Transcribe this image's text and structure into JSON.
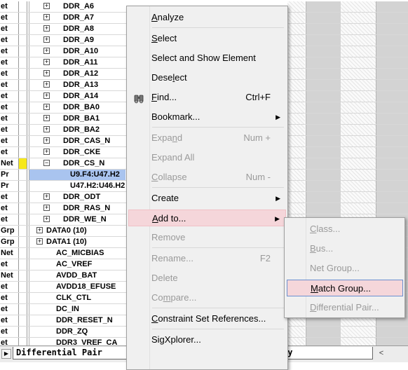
{
  "rows": [
    {
      "type": "et",
      "mark": false,
      "toggle": "+",
      "indent": 1,
      "name": "DDR_A6",
      "highlight": false
    },
    {
      "type": "et",
      "mark": false,
      "toggle": "+",
      "indent": 1,
      "name": "DDR_A7",
      "highlight": false
    },
    {
      "type": "et",
      "mark": false,
      "toggle": "+",
      "indent": 1,
      "name": "DDR_A8",
      "highlight": false
    },
    {
      "type": "et",
      "mark": false,
      "toggle": "+",
      "indent": 1,
      "name": "DDR_A9",
      "highlight": false
    },
    {
      "type": "et",
      "mark": false,
      "toggle": "+",
      "indent": 1,
      "name": "DDR_A10",
      "highlight": false
    },
    {
      "type": "et",
      "mark": false,
      "toggle": "+",
      "indent": 1,
      "name": "DDR_A11",
      "highlight": false
    },
    {
      "type": "et",
      "mark": false,
      "toggle": "+",
      "indent": 1,
      "name": "DDR_A12",
      "highlight": false
    },
    {
      "type": "et",
      "mark": false,
      "toggle": "+",
      "indent": 1,
      "name": "DDR_A13",
      "highlight": false
    },
    {
      "type": "et",
      "mark": false,
      "toggle": "+",
      "indent": 1,
      "name": "DDR_A14",
      "highlight": false
    },
    {
      "type": "et",
      "mark": false,
      "toggle": "+",
      "indent": 1,
      "name": "DDR_BA0",
      "highlight": false
    },
    {
      "type": "et",
      "mark": false,
      "toggle": "+",
      "indent": 1,
      "name": "DDR_BA1",
      "highlight": false
    },
    {
      "type": "et",
      "mark": false,
      "toggle": "+",
      "indent": 1,
      "name": "DDR_BA2",
      "highlight": false
    },
    {
      "type": "et",
      "mark": false,
      "toggle": "+",
      "indent": 1,
      "name": "DDR_CAS_N",
      "highlight": false
    },
    {
      "type": "et",
      "mark": false,
      "toggle": "+",
      "indent": 1,
      "name": "DDR_CKE",
      "highlight": false
    },
    {
      "type": "Net",
      "mark": true,
      "toggle": "−",
      "indent": 1,
      "name": "DDR_CS_N",
      "highlight": false
    },
    {
      "type": "Pr",
      "mark": false,
      "toggle": "",
      "indent": 2,
      "name": "U9.F4:U47.H2",
      "highlight": true
    },
    {
      "type": "Pr",
      "mark": false,
      "toggle": "",
      "indent": 2,
      "name": "U47.H2:U46.H2",
      "highlight": false
    },
    {
      "type": "et",
      "mark": false,
      "toggle": "+",
      "indent": 1,
      "name": "DDR_ODT",
      "highlight": false
    },
    {
      "type": "et",
      "mark": false,
      "toggle": "+",
      "indent": 1,
      "name": "DDR_RAS_N",
      "highlight": false
    },
    {
      "type": "et",
      "mark": false,
      "toggle": "+",
      "indent": 1,
      "name": "DDR_WE_N",
      "highlight": false
    },
    {
      "type": "Grp",
      "mark": false,
      "toggle": "+",
      "indent": 0,
      "name": "DATA0 (10)",
      "highlight": false
    },
    {
      "type": "Grp",
      "mark": false,
      "toggle": "+",
      "indent": 0,
      "name": "DATA1 (10)",
      "highlight": false
    },
    {
      "type": "Net",
      "mark": false,
      "toggle": "",
      "indent": 1,
      "name": "AC_MICBIAS",
      "highlight": false
    },
    {
      "type": "et",
      "mark": false,
      "toggle": "",
      "indent": 1,
      "name": "AC_VREF",
      "highlight": false
    },
    {
      "type": "Net",
      "mark": false,
      "toggle": "",
      "indent": 1,
      "name": "AVDD_BAT",
      "highlight": false
    },
    {
      "type": "et",
      "mark": false,
      "toggle": "",
      "indent": 1,
      "name": "AVDD18_EFUSE",
      "highlight": false
    },
    {
      "type": "et",
      "mark": false,
      "toggle": "",
      "indent": 1,
      "name": "CLK_CTL",
      "highlight": false
    },
    {
      "type": "et",
      "mark": false,
      "toggle": "",
      "indent": 1,
      "name": "DC_IN",
      "highlight": false
    },
    {
      "type": "et",
      "mark": false,
      "toggle": "",
      "indent": 1,
      "name": "DDR_RESET_N",
      "highlight": false
    },
    {
      "type": "et",
      "mark": false,
      "toggle": "",
      "indent": 1,
      "name": "DDR_ZQ",
      "highlight": false
    },
    {
      "type": "et",
      "mark": false,
      "toggle": "",
      "indent": 1,
      "name": "DDR3_VREF_CA",
      "highlight": false
    }
  ],
  "bottom_tabs": {
    "left": "Differential Pair",
    "right": "ay"
  },
  "context_menu": [
    {
      "label": "Analyze",
      "underline": 0,
      "shortcut": "",
      "submenu": false,
      "disabled": false,
      "hot": false,
      "sep_after": true
    },
    {
      "label": "Select",
      "underline": 0,
      "shortcut": "",
      "submenu": false,
      "disabled": false,
      "hot": false,
      "sep_after": false
    },
    {
      "label": "Select and Show Element",
      "underline": -1,
      "shortcut": "",
      "submenu": false,
      "disabled": false,
      "hot": false,
      "sep_after": false
    },
    {
      "label": "Deselect",
      "underline": 4,
      "shortcut": "",
      "submenu": false,
      "disabled": false,
      "hot": false,
      "sep_after": false
    },
    {
      "label": "Find...",
      "underline": 0,
      "shortcut": "Ctrl+F",
      "submenu": false,
      "disabled": false,
      "hot": false,
      "sep_after": false,
      "icon": "binoculars-icon"
    },
    {
      "label": "Bookmark...",
      "underline": -1,
      "shortcut": "",
      "submenu": true,
      "disabled": false,
      "hot": false,
      "sep_after": true
    },
    {
      "label": "Expand",
      "underline": 4,
      "shortcut": "Num +",
      "submenu": false,
      "disabled": true,
      "hot": false,
      "sep_after": false
    },
    {
      "label": "Expand All",
      "underline": -1,
      "shortcut": "",
      "submenu": false,
      "disabled": true,
      "hot": false,
      "sep_after": false
    },
    {
      "label": "Collapse",
      "underline": 0,
      "shortcut": "Num -",
      "submenu": false,
      "disabled": true,
      "hot": false,
      "sep_after": true
    },
    {
      "label": "Create",
      "underline": -1,
      "shortcut": "",
      "submenu": true,
      "disabled": false,
      "hot": false,
      "sep_after": false
    },
    {
      "label": "Add to...",
      "underline": 0,
      "shortcut": "",
      "submenu": true,
      "disabled": false,
      "hot": true,
      "sep_after": false
    },
    {
      "label": "Remove",
      "underline": -1,
      "shortcut": "",
      "submenu": false,
      "disabled": true,
      "hot": false,
      "sep_after": true
    },
    {
      "label": "Rename...",
      "underline": -1,
      "shortcut": "F2",
      "submenu": false,
      "disabled": true,
      "hot": false,
      "sep_after": false
    },
    {
      "label": "Delete",
      "underline": -1,
      "shortcut": "",
      "submenu": false,
      "disabled": true,
      "hot": false,
      "sep_after": false
    },
    {
      "label": "Compare...",
      "underline": 2,
      "shortcut": "",
      "submenu": false,
      "disabled": true,
      "hot": false,
      "sep_after": true
    },
    {
      "label": "Constraint Set References...",
      "underline": 0,
      "shortcut": "",
      "submenu": false,
      "disabled": false,
      "hot": false,
      "sep_after": true
    },
    {
      "label": "SigXplorer...",
      "underline": -1,
      "shortcut": "",
      "submenu": false,
      "disabled": false,
      "hot": false,
      "sep_after": false
    }
  ],
  "sub_menu": [
    {
      "label": "Class...",
      "underline": 0,
      "disabled": true,
      "hot": false
    },
    {
      "label": "Bus...",
      "underline": 0,
      "disabled": true,
      "hot": false
    },
    {
      "label": "Net Group...",
      "underline": -1,
      "disabled": true,
      "hot": false
    },
    {
      "label": "Match Group...",
      "underline": 0,
      "disabled": false,
      "hot": true
    },
    {
      "label": "Differential Pair...",
      "underline": 0,
      "disabled": true,
      "hot": false
    }
  ],
  "colors": {
    "menu_highlight": "#f5d6da",
    "selected_row": "#a9c4ef",
    "marker": "#f7e81a"
  }
}
